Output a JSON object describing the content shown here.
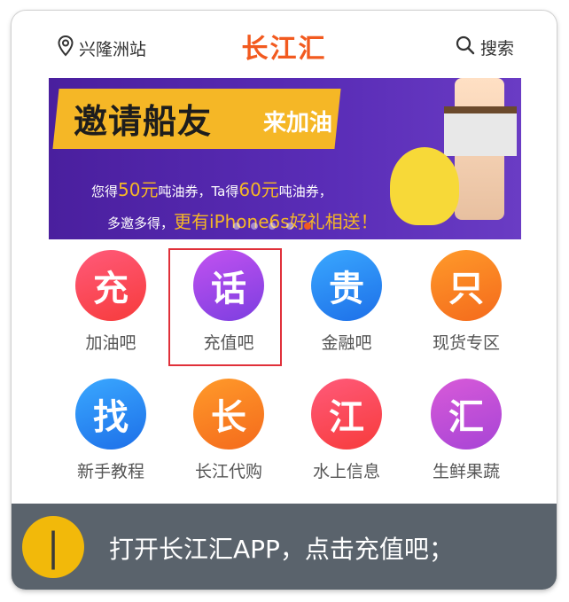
{
  "header": {
    "location": "兴隆洲站",
    "brand": "长江汇",
    "search_label": "搜索"
  },
  "banner": {
    "headline": "邀请船友",
    "headline_emphasis": "来加油",
    "line1_a": "您得",
    "line1_b": "50元",
    "line1_c": "吨油券，Ta得",
    "line1_d": "60元",
    "line1_e": "吨油券，",
    "line2_a": "多邀多得，",
    "line2_b": "更有iPhone6s好礼相送！",
    "dots_total": 5,
    "dot_active_index": 4
  },
  "grid": {
    "items": [
      {
        "glyph": "充",
        "label": "加油吧",
        "color_from": "#ff5a7a",
        "color_to": "#f73b3b"
      },
      {
        "glyph": "话",
        "label": "充值吧",
        "color_from": "#c252f0",
        "color_to": "#7c3ee0"
      },
      {
        "glyph": "贵",
        "label": "金融吧",
        "color_from": "#3aa8ff",
        "color_to": "#1d6fe8"
      },
      {
        "glyph": "只",
        "label": "现货专区",
        "color_from": "#ff9a2a",
        "color_to": "#f46a1c"
      },
      {
        "glyph": "找",
        "label": "新手教程",
        "color_from": "#3aa8ff",
        "color_to": "#1d6fe8"
      },
      {
        "glyph": "长",
        "label": "长江代购",
        "color_from": "#ff9a2a",
        "color_to": "#f46a1c"
      },
      {
        "glyph": "江",
        "label": "水上信息",
        "color_from": "#ff5a7a",
        "color_to": "#f73b3b"
      },
      {
        "glyph": "汇",
        "label": "生鲜果蔬",
        "color_from": "#d85ad8",
        "color_to": "#a744d6"
      }
    ]
  },
  "instruction": {
    "step": "|",
    "text": "打开长江汇APP，点击充值吧；"
  },
  "colors": {
    "brand": "#f25a1f",
    "highlight": "#e0303a",
    "bottom_bar": "#5a636c",
    "step_badge": "#f2b90a"
  }
}
